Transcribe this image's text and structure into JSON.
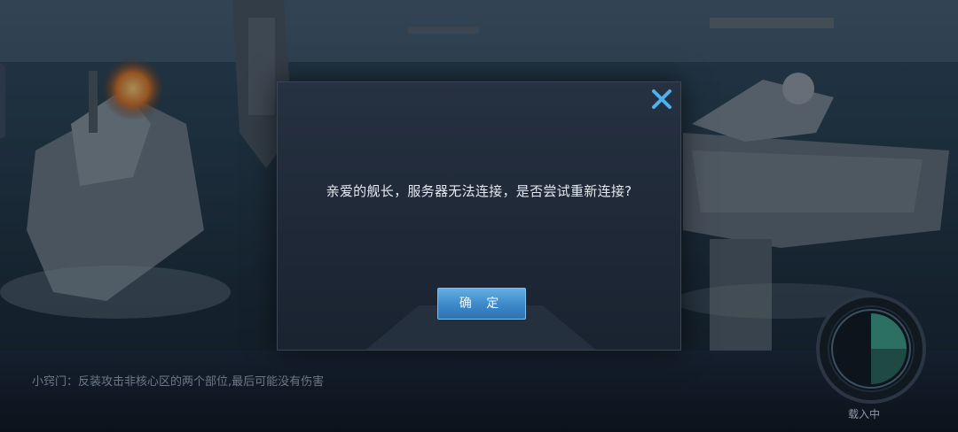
{
  "dialog": {
    "message": "亲爱的舰长，服务器无法连接，是否尝试重新连接?",
    "confirm_label": "确 定",
    "close_icon": "close-icon"
  },
  "footer": {
    "tip": "小窍门：反装攻击非核心区的两个部位,最后可能没有伤害",
    "loading_label": "载入中"
  },
  "colors": {
    "accent": "#4a9ad8",
    "close": "#4fb0ee",
    "dialog_bg": "#222c3a"
  }
}
